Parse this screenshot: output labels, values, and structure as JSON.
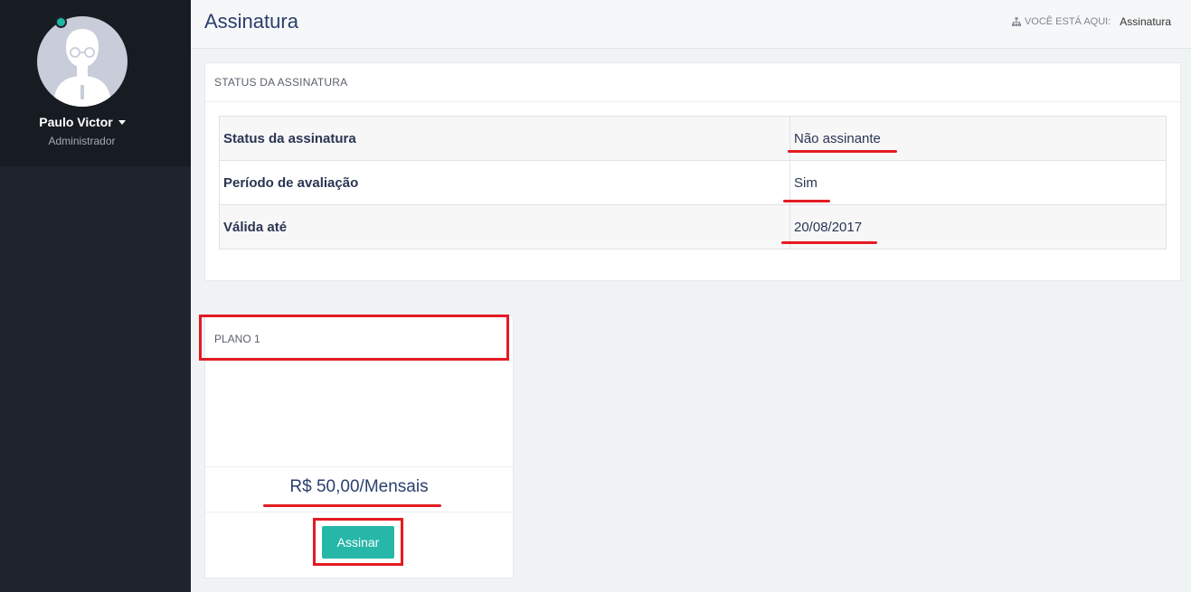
{
  "user": {
    "name": "Paulo Victor",
    "role": "Administrador"
  },
  "header": {
    "title": "Assinatura",
    "breadcrumb_label": "VOCÊ ESTÁ AQUI:",
    "breadcrumb_current": "Assinatura"
  },
  "status_panel": {
    "heading": "STATUS DA ASSINATURA",
    "rows": [
      {
        "label": "Status da assinatura",
        "value": "Não assinante"
      },
      {
        "label": "Período de avaliação",
        "value": "Sim"
      },
      {
        "label": "Válida até",
        "value": "20/08/2017"
      }
    ]
  },
  "plan": {
    "heading": "PLANO 1",
    "price": "R$ 50,00/Mensais",
    "button_label": "Assinar"
  },
  "colors": {
    "sidebar": "#1e232e",
    "accent": "#27b7a8",
    "highlight": "#e31b23",
    "title": "#2a3f6b"
  }
}
